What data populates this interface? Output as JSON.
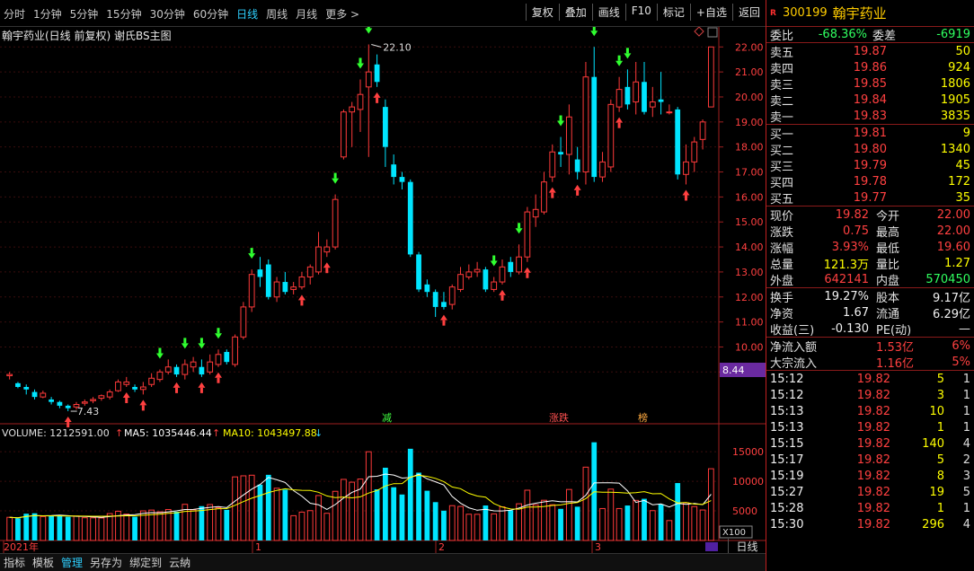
{
  "toolbar": {
    "periods": [
      "分时",
      "1分钟",
      "5分钟",
      "15分钟",
      "30分钟",
      "60分钟",
      "日线",
      "周线",
      "月线",
      "更多 >"
    ],
    "active_period": "日线",
    "actions": [
      "复权",
      "叠加",
      "画线",
      "F10",
      "标记",
      "+自选",
      "返回"
    ]
  },
  "chart": {
    "title": "翰宇药业(日线 前复权) 谢氏BS主图",
    "high_label": "22.10",
    "low_label": "7.43",
    "price_ticks": [
      "22.00",
      "21.00",
      "20.00",
      "19.00",
      "18.00",
      "17.00",
      "16.00",
      "15.00",
      "14.00",
      "13.00",
      "12.00",
      "11.00",
      "10.00",
      "9.00"
    ],
    "current_marker": "8.44",
    "markers": {
      "jian": "减",
      "zhangdie": "涨跌",
      "bang": "榜"
    },
    "volume_header": {
      "volume": "VOLUME: 1212591.00",
      "ma5": "MA5: 1035446.44",
      "ma10": "MA10: 1043497.88"
    },
    "vol_ticks": [
      "15000",
      "10000",
      "5000"
    ],
    "vol_unit": "X100",
    "date_labels": [
      "2021年",
      "1",
      "2",
      "3"
    ],
    "period_label": "日线",
    "colors": {
      "up": "#ff3a3a",
      "down": "#00e5ff",
      "ma5": "#ffffff",
      "ma10": "#ffff00"
    }
  },
  "panel": {
    "code": "300199",
    "name": "翰宇药业",
    "weibi_label": "委比",
    "weibi": "-68.36%",
    "weicha_label": "委差",
    "weicha": "-6919",
    "sells": [
      {
        "label": "卖五",
        "price": "19.87",
        "vol": "50"
      },
      {
        "label": "卖四",
        "price": "19.86",
        "vol": "924"
      },
      {
        "label": "卖三",
        "price": "19.85",
        "vol": "1806"
      },
      {
        "label": "卖二",
        "price": "19.84",
        "vol": "1905"
      },
      {
        "label": "卖一",
        "price": "19.83",
        "vol": "3835"
      }
    ],
    "buys": [
      {
        "label": "买一",
        "price": "19.81",
        "vol": "9"
      },
      {
        "label": "买二",
        "price": "19.80",
        "vol": "1340"
      },
      {
        "label": "买三",
        "price": "19.79",
        "vol": "45"
      },
      {
        "label": "买四",
        "price": "19.78",
        "vol": "172"
      },
      {
        "label": "买五",
        "price": "19.77",
        "vol": "35"
      }
    ],
    "quote1": [
      {
        "l1": "现价",
        "v1": "19.82",
        "l2": "今开",
        "v2": "22.00"
      },
      {
        "l1": "涨跌",
        "v1": "0.75",
        "l2": "最高",
        "v2": "22.00"
      },
      {
        "l1": "涨幅",
        "v1": "3.93%",
        "l2": "最低",
        "v2": "19.60"
      },
      {
        "l1": "总量",
        "v1": "121.3万",
        "l2": "量比",
        "v2": "1.27"
      },
      {
        "l1": "外盘",
        "v1": "642141",
        "l2": "内盘",
        "v2": "570450"
      }
    ],
    "quote2": [
      {
        "l1": "换手",
        "v1": "19.27%",
        "l2": "股本",
        "v2": "9.17亿"
      },
      {
        "l1": "净资",
        "v1": "1.67",
        "l2": "流通",
        "v2": "6.29亿"
      },
      {
        "l1": "收益(三)",
        "v1": "-0.130",
        "l2": "PE(动)",
        "v2": "—"
      }
    ],
    "flows": [
      {
        "label": "净流入额",
        "value": "1.53亿",
        "pct": "6%"
      },
      {
        "label": "大宗流入",
        "value": "1.16亿",
        "pct": "5%"
      }
    ],
    "ticks": [
      {
        "t": "15:12",
        "p": "19.82",
        "v": "5",
        "n": "1"
      },
      {
        "t": "15:12",
        "p": "19.82",
        "v": "3",
        "n": "1"
      },
      {
        "t": "15:13",
        "p": "19.82",
        "v": "10",
        "n": "1"
      },
      {
        "t": "15:13",
        "p": "19.82",
        "v": "1",
        "n": "1"
      },
      {
        "t": "15:15",
        "p": "19.82",
        "v": "140",
        "n": "4"
      },
      {
        "t": "15:17",
        "p": "19.82",
        "v": "5",
        "n": "2"
      },
      {
        "t": "15:19",
        "p": "19.82",
        "v": "8",
        "n": "3"
      },
      {
        "t": "15:27",
        "p": "19.82",
        "v": "19",
        "n": "5"
      },
      {
        "t": "15:28",
        "p": "19.82",
        "v": "1",
        "n": "1"
      },
      {
        "t": "15:30",
        "p": "19.82",
        "v": "296",
        "n": "4"
      }
    ]
  },
  "bottom_tabs": [
    "指标",
    "模板",
    "管理",
    "另存为",
    "绑定到",
    "云納"
  ],
  "active_tab": "管理",
  "candles": [
    [
      8.85,
      8.9,
      8.7,
      9.0
    ],
    [
      8.55,
      8.4,
      8.35,
      8.6
    ],
    [
      8.4,
      8.3,
      8.1,
      8.5
    ],
    [
      8.2,
      8.0,
      7.9,
      8.3
    ],
    [
      8.0,
      8.15,
      7.95,
      8.25
    ],
    [
      7.9,
      7.8,
      7.7,
      8.0
    ],
    [
      7.8,
      7.65,
      7.55,
      7.85
    ],
    [
      7.65,
      7.55,
      7.43,
      7.7
    ],
    [
      7.6,
      7.7,
      7.5,
      7.8
    ],
    [
      7.75,
      7.8,
      7.65,
      7.9
    ],
    [
      7.85,
      7.9,
      7.75,
      8.0
    ],
    [
      7.95,
      8.05,
      7.85,
      8.1
    ],
    [
      8.0,
      8.2,
      7.9,
      8.3
    ],
    [
      8.25,
      8.6,
      8.2,
      8.7
    ],
    [
      8.5,
      8.6,
      8.4,
      8.8
    ],
    [
      8.4,
      8.3,
      8.2,
      8.5
    ],
    [
      8.3,
      8.4,
      8.1,
      8.6
    ],
    [
      8.5,
      8.75,
      8.4,
      8.95
    ],
    [
      8.7,
      9.0,
      8.6,
      9.1
    ],
    [
      9.0,
      9.2,
      8.9,
      9.5
    ],
    [
      9.2,
      8.9,
      8.8,
      9.3
    ],
    [
      8.9,
      9.3,
      8.7,
      9.5
    ],
    [
      9.2,
      9.4,
      9.0,
      9.6
    ],
    [
      9.2,
      8.9,
      8.8,
      9.5
    ],
    [
      9.0,
      9.4,
      8.9,
      9.7
    ],
    [
      9.3,
      9.7,
      9.2,
      9.9
    ],
    [
      9.8,
      9.4,
      9.3,
      9.9
    ],
    [
      9.3,
      10.4,
      9.2,
      10.5
    ],
    [
      10.4,
      11.6,
      10.3,
      11.8
    ],
    [
      11.6,
      12.9,
      11.4,
      13.1
    ],
    [
      13.1,
      12.8,
      12.4,
      13.6
    ],
    [
      13.3,
      12.0,
      11.9,
      13.5
    ],
    [
      12.0,
      12.6,
      11.8,
      12.8
    ],
    [
      12.6,
      12.2,
      12.1,
      13.0
    ],
    [
      12.3,
      12.4,
      12.1,
      12.6
    ],
    [
      12.4,
      12.8,
      12.3,
      13.0
    ],
    [
      12.8,
      13.2,
      12.5,
      13.3
    ],
    [
      13.0,
      14.0,
      12.9,
      14.6
    ],
    [
      13.8,
      14.0,
      13.6,
      14.3
    ],
    [
      14.0,
      15.9,
      13.9,
      16.1
    ],
    [
      17.6,
      19.4,
      17.5,
      19.5
    ],
    [
      19.4,
      19.6,
      18.0,
      19.8
    ],
    [
      19.5,
      20.1,
      18.6,
      20.7
    ],
    [
      20.4,
      21.0,
      17.6,
      22.1
    ],
    [
      21.3,
      20.6,
      20.4,
      21.7
    ],
    [
      19.6,
      18.0,
      17.2,
      19.9
    ],
    [
      17.3,
      16.8,
      16.5,
      17.7
    ],
    [
      16.8,
      16.6,
      16.3,
      17.0
    ],
    [
      16.6,
      13.7,
      13.6,
      16.7
    ],
    [
      13.7,
      12.3,
      12.2,
      13.8
    ],
    [
      12.5,
      12.2,
      12.0,
      12.7
    ],
    [
      12.2,
      11.6,
      11.2,
      12.3
    ],
    [
      11.8,
      11.6,
      11.5,
      12.2
    ],
    [
      11.7,
      12.4,
      11.5,
      12.5
    ],
    [
      12.3,
      12.9,
      12.2,
      13.2
    ],
    [
      12.8,
      13.0,
      12.7,
      13.3
    ],
    [
      13.0,
      13.1,
      12.8,
      13.4
    ],
    [
      13.1,
      12.3,
      12.2,
      13.2
    ],
    [
      12.3,
      12.6,
      12.2,
      12.8
    ],
    [
      12.6,
      13.2,
      12.5,
      13.5
    ],
    [
      13.4,
      13.0,
      12.8,
      13.6
    ],
    [
      13.0,
      13.6,
      12.9,
      14.1
    ],
    [
      13.6,
      15.4,
      13.4,
      15.6
    ],
    [
      15.2,
      15.5,
      14.8,
      16.1
    ],
    [
      15.4,
      16.6,
      15.3,
      17.0
    ],
    [
      16.8,
      17.8,
      16.6,
      18.1
    ],
    [
      17.8,
      17.7,
      17.2,
      18.4
    ],
    [
      17.7,
      19.2,
      16.9,
      19.7
    ],
    [
      17.5,
      17.0,
      16.7,
      18.0
    ],
    [
      17.0,
      20.8,
      16.5,
      21.4
    ],
    [
      20.8,
      16.8,
      16.6,
      22.0
    ],
    [
      16.8,
      17.4,
      16.6,
      17.8
    ],
    [
      17.2,
      19.7,
      17.0,
      19.9
    ],
    [
      19.6,
      20.3,
      19.4,
      20.8
    ],
    [
      20.4,
      19.7,
      19.5,
      21.1
    ],
    [
      19.8,
      20.6,
      19.3,
      21.4
    ],
    [
      20.6,
      19.4,
      19.3,
      21.4
    ],
    [
      19.6,
      19.8,
      19.2,
      20.4
    ],
    [
      19.9,
      19.8,
      19.3,
      21.0
    ],
    [
      19.4,
      19.4,
      19.3,
      19.7
    ],
    [
      19.5,
      16.9,
      16.7,
      19.6
    ],
    [
      16.9,
      17.4,
      16.5,
      18.1
    ],
    [
      17.4,
      18.2,
      17.0,
      18.4
    ],
    [
      18.3,
      19.0,
      17.9,
      19.1
    ],
    [
      19.6,
      22.0,
      19.6,
      22.0
    ]
  ]
}
